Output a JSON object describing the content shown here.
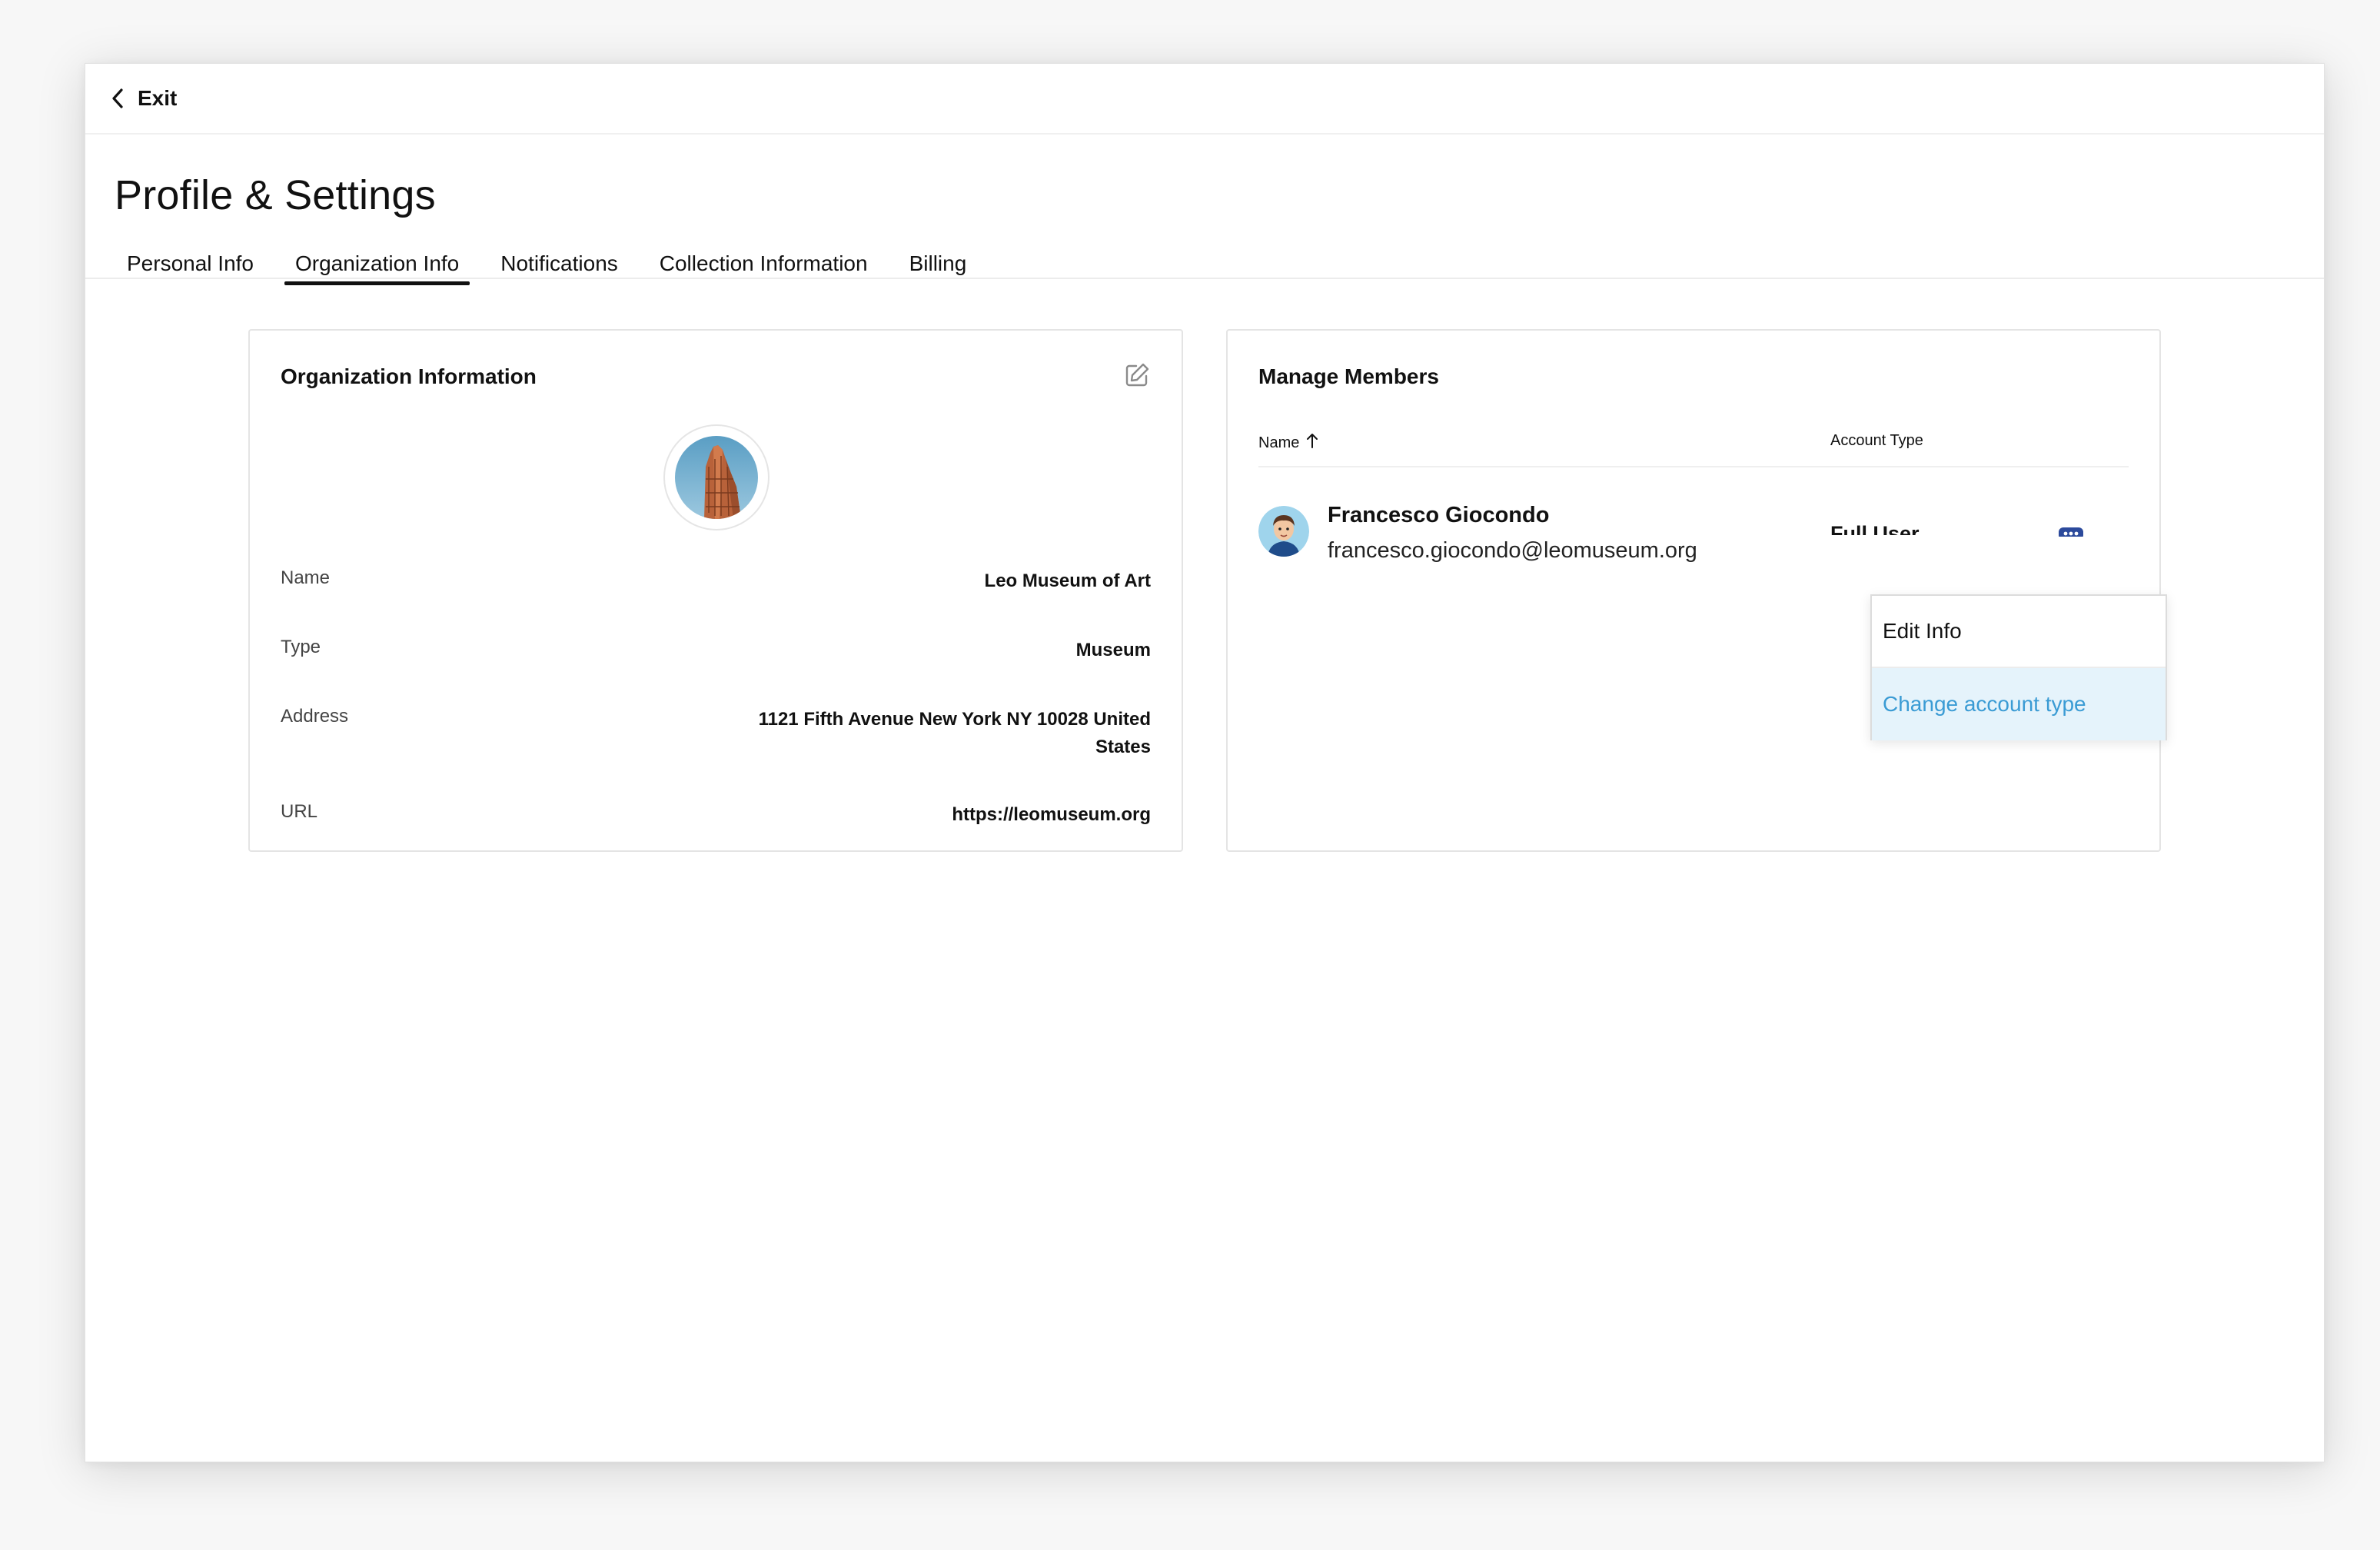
{
  "topbar": {
    "exit_label": "Exit"
  },
  "page": {
    "title": "Profile & Settings"
  },
  "tabs": [
    {
      "label": "Personal Info",
      "active": false
    },
    {
      "label": "Organization Info",
      "active": true
    },
    {
      "label": "Notifications",
      "active": false
    },
    {
      "label": "Collection Information",
      "active": false
    },
    {
      "label": "Billing",
      "active": false
    }
  ],
  "org_card": {
    "title": "Organization Information",
    "fields": [
      {
        "label": "Name",
        "value": "Leo Museum of Art"
      },
      {
        "label": "Type",
        "value": "Museum"
      },
      {
        "label": "Address",
        "value": "1121 Fifth Avenue New York NY 10028 United States"
      },
      {
        "label": "URL",
        "value": "https://leomuseum.org"
      }
    ]
  },
  "members_card": {
    "title": "Manage Members",
    "columns": {
      "name": "Name",
      "account_type": "Account Type"
    },
    "members": [
      {
        "name": "Francesco Giocondo",
        "email": "francesco.giocondo@leomuseum.org",
        "account_type": "Full User"
      }
    ]
  },
  "menu": {
    "items": [
      "Edit Info",
      "Change account type"
    ],
    "highlighted": "Change account type"
  },
  "colors": {
    "accent_blue": "#3a9bd4",
    "highlight_bg": "#e5f3fb",
    "more_icon": "#2c4a9c"
  },
  "icons": {
    "exit": "chevron-left-icon",
    "edit": "edit-icon",
    "sort": "arrow-up-icon",
    "more": "more-options-icon"
  }
}
